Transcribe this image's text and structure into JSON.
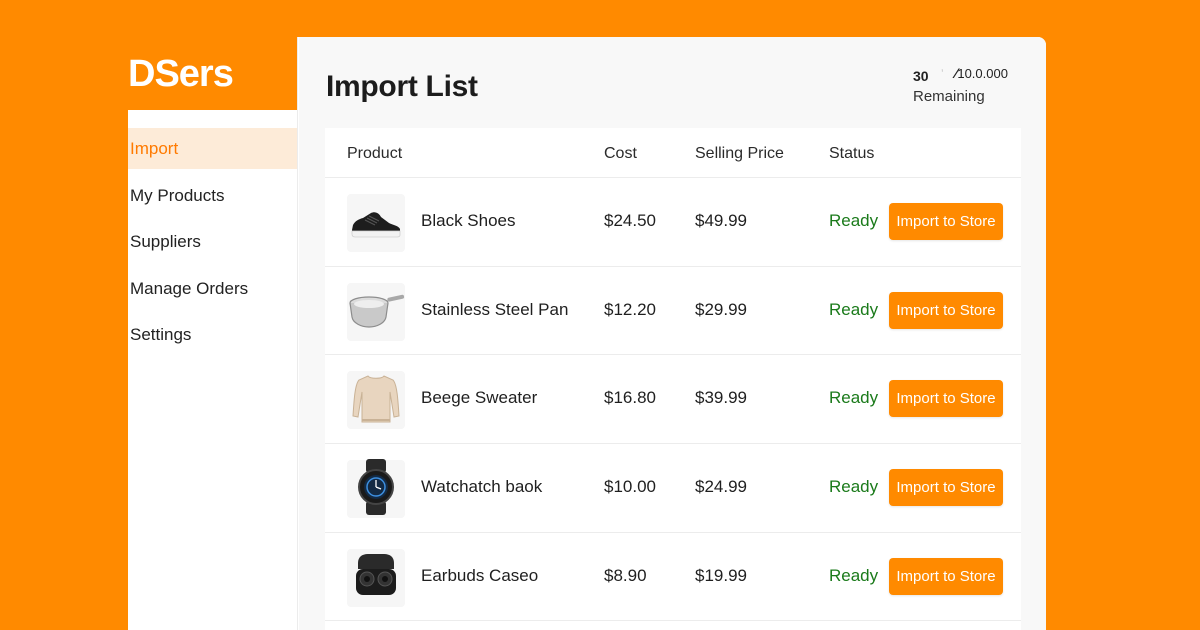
{
  "brand": {
    "name": "DSers"
  },
  "sidebar": {
    "items": [
      {
        "label": "Import",
        "active": true
      },
      {
        "label": "My Products",
        "active": false
      },
      {
        "label": "Suppliers",
        "active": false
      },
      {
        "label": "Manage Orders",
        "active": false
      },
      {
        "label": "Settings",
        "active": false
      }
    ]
  },
  "header": {
    "title": "Import List",
    "quota": {
      "used": "30",
      "separator": "⁄",
      "total": "10.0.000",
      "label": "Remaining"
    }
  },
  "table": {
    "columns": [
      "Product",
      "Cost",
      "Selling Price",
      "Status"
    ],
    "rows": [
      {
        "name": "Black Shoes",
        "cost": "$24.50",
        "price": "$49.99",
        "status": "Ready",
        "action": "Import to Store",
        "icon": "shoe-icon"
      },
      {
        "name": "Stainless Steel Pan",
        "cost": "$12.20",
        "price": "$29.99",
        "status": "Ready",
        "action": "Import to Store",
        "icon": "pan-icon"
      },
      {
        "name": "Beege Sweater",
        "cost": "$16.80",
        "price": "$39.99",
        "status": "Ready",
        "action": "Import to Store",
        "icon": "sweater-icon"
      },
      {
        "name": "Watchatch baok",
        "cost": "$10.00",
        "price": "$24.99",
        "status": "Ready",
        "action": "Import to Store",
        "icon": "watch-icon"
      },
      {
        "name": "Earbuds Caseo",
        "cost": "$8.90",
        "price": "$19.99",
        "status": "Ready",
        "action": "Import to Store",
        "icon": "earbuds-icon"
      }
    ]
  },
  "colors": {
    "accent": "#ff8a00",
    "status_ready": "#1a7a1a",
    "active_bg": "#fdebd8"
  }
}
